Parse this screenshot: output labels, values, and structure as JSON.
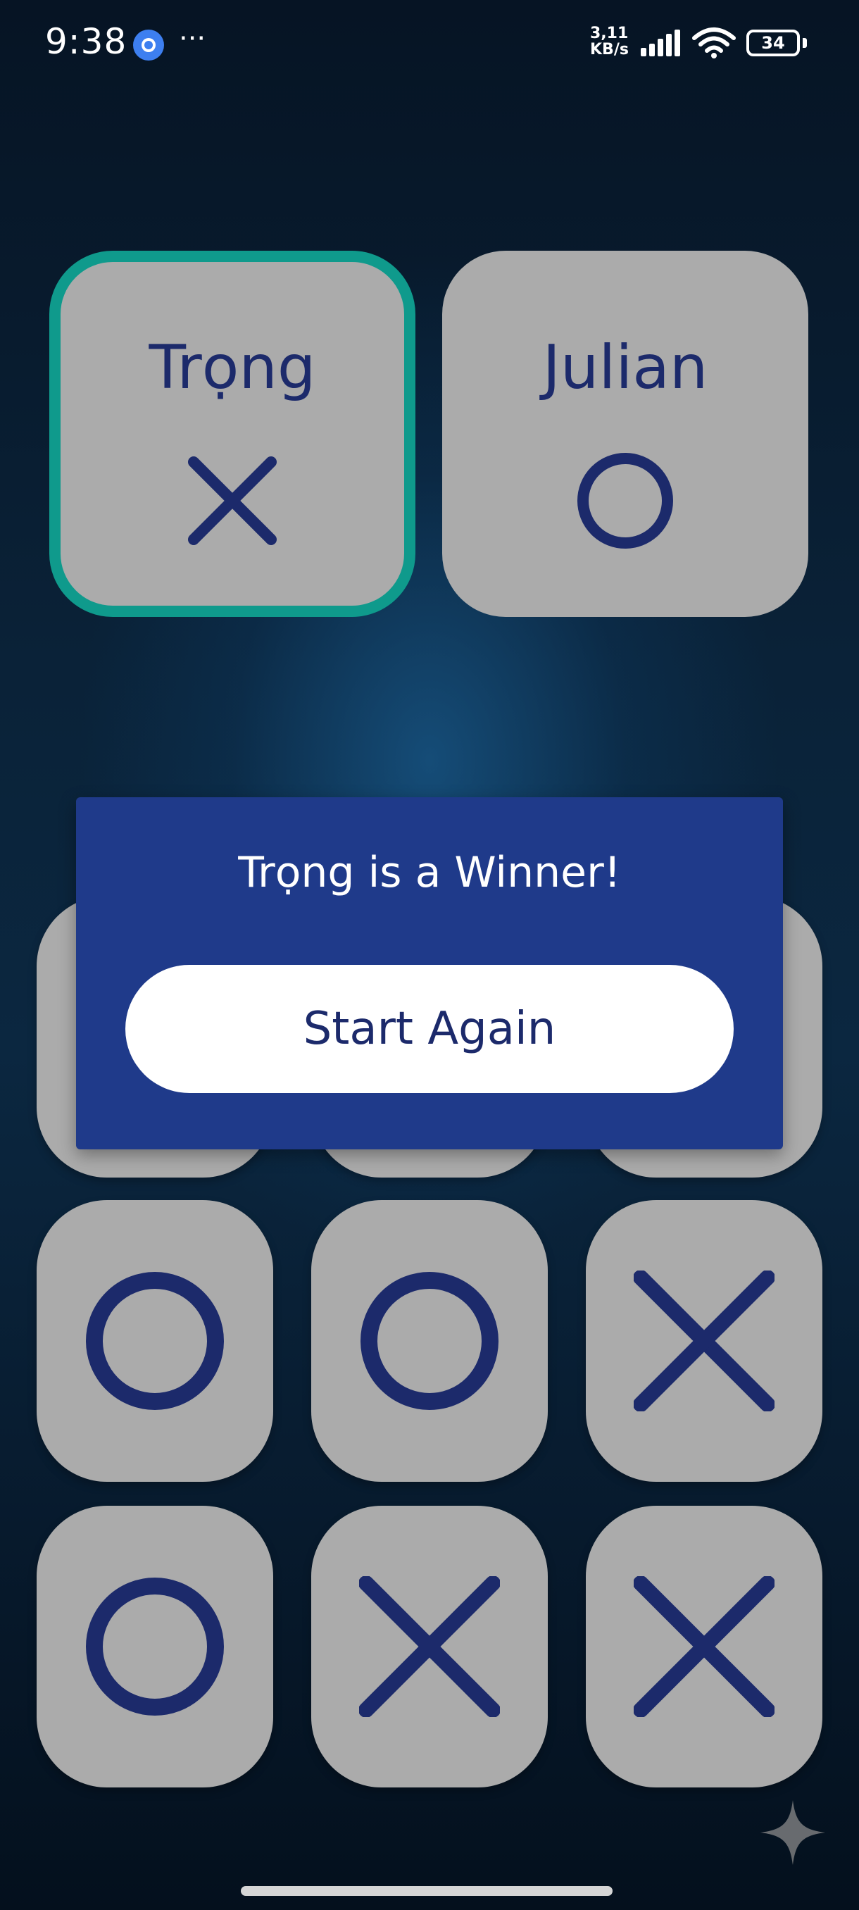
{
  "status_bar": {
    "time": "9:38",
    "more": "···",
    "net_speed_value": "3,11",
    "net_speed_unit": "KB/s",
    "battery": "34",
    "icons": [
      "app-notification-icon",
      "signal-icon",
      "wifi-icon",
      "battery-icon"
    ]
  },
  "players": [
    {
      "name": "Trọng",
      "symbol": "X",
      "active": true
    },
    {
      "name": "Julian",
      "symbol": "O",
      "active": false
    }
  ],
  "board": {
    "cells": [
      "hidden",
      "hidden",
      "hidden",
      "O",
      "O",
      "X",
      "O",
      "X",
      "X"
    ]
  },
  "dialog": {
    "message": "Trọng is a Winner!",
    "button_label": "Start Again"
  },
  "colors": {
    "background": "#0a2238",
    "tile": "#ababab",
    "mark": "#1c2a6b",
    "active_border": "#0f9a8c",
    "dialog": "#1f3a8a",
    "button": "#ffffff"
  }
}
